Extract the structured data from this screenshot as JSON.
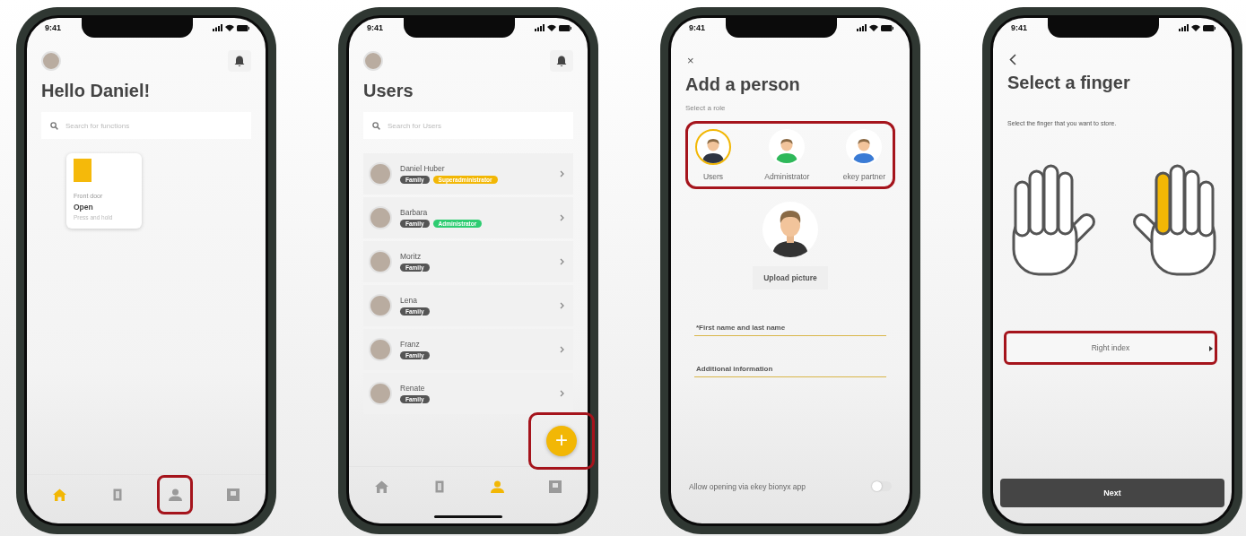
{
  "screens": [
    {
      "kind": "home",
      "time": "9:41",
      "title": "Hello Daniel!",
      "search": {
        "placeholder": "Search for functions"
      },
      "tile": {
        "label": "Front door",
        "action": "Open",
        "hint": "Press and hold"
      },
      "nav": [
        {
          "kind": "home",
          "selected": true,
          "highlighted": false
        },
        {
          "kind": "door",
          "selected": false,
          "highlighted": false
        },
        {
          "kind": "person",
          "selected": false,
          "highlighted": true
        },
        {
          "kind": "box",
          "selected": false,
          "highlighted": false
        }
      ]
    },
    {
      "kind": "users",
      "time": "9:41",
      "title": "Users",
      "search": {
        "placeholder": "Search for Users"
      },
      "rows": [
        {
          "name": "Daniel Huber",
          "badges": [
            {
              "text": "Family",
              "color": "#555555"
            },
            {
              "text": "Superadministrator",
              "color": "#f2b705"
            }
          ]
        },
        {
          "name": "Barbara",
          "badges": [
            {
              "text": "Family",
              "color": "#555555"
            },
            {
              "text": "Administrator",
              "color": "#2ecc71"
            }
          ]
        },
        {
          "name": "Moritz",
          "badges": [
            {
              "text": "Family",
              "color": "#555555"
            }
          ]
        },
        {
          "name": "Lena",
          "badges": [
            {
              "text": "Family",
              "color": "#555555"
            }
          ]
        },
        {
          "name": "Franz",
          "badges": [
            {
              "text": "Family",
              "color": "#555555"
            }
          ]
        },
        {
          "name": "Renate",
          "badges": [
            {
              "text": "Family",
              "color": "#555555"
            }
          ]
        }
      ],
      "fab": {
        "label": "+",
        "highlighted": true
      },
      "nav": [
        {
          "kind": "home",
          "selected": false,
          "highlighted": false
        },
        {
          "kind": "door",
          "selected": false,
          "highlighted": false
        },
        {
          "kind": "person",
          "selected": true,
          "highlighted": false
        },
        {
          "kind": "box",
          "selected": false,
          "highlighted": false
        }
      ]
    },
    {
      "kind": "add_person",
      "time": "9:41",
      "close": "×",
      "title": "Add a person",
      "role_prompt": "Select a role",
      "roles": {
        "highlighted": true,
        "items": [
          {
            "label": "Users",
            "color": "#2f3542",
            "selected": true
          },
          {
            "label": "Administrator",
            "color": "#2fb85a",
            "selected": false
          },
          {
            "label": "ekey partner",
            "color": "#3a7bd5",
            "selected": false
          }
        ]
      },
      "upload": "Upload picture",
      "fields": [
        {
          "placeholder": "*First name and last name"
        },
        {
          "placeholder": "Additional information"
        }
      ],
      "toggle": {
        "label": "Allow opening via ekey bionyx app",
        "on": false
      }
    },
    {
      "kind": "select_finger",
      "time": "9:41",
      "title": "Select a finger",
      "subtitle": "Select the finger that you want to store.",
      "finger": {
        "value": "Right index",
        "highlighted": true
      },
      "button": "Next"
    }
  ]
}
